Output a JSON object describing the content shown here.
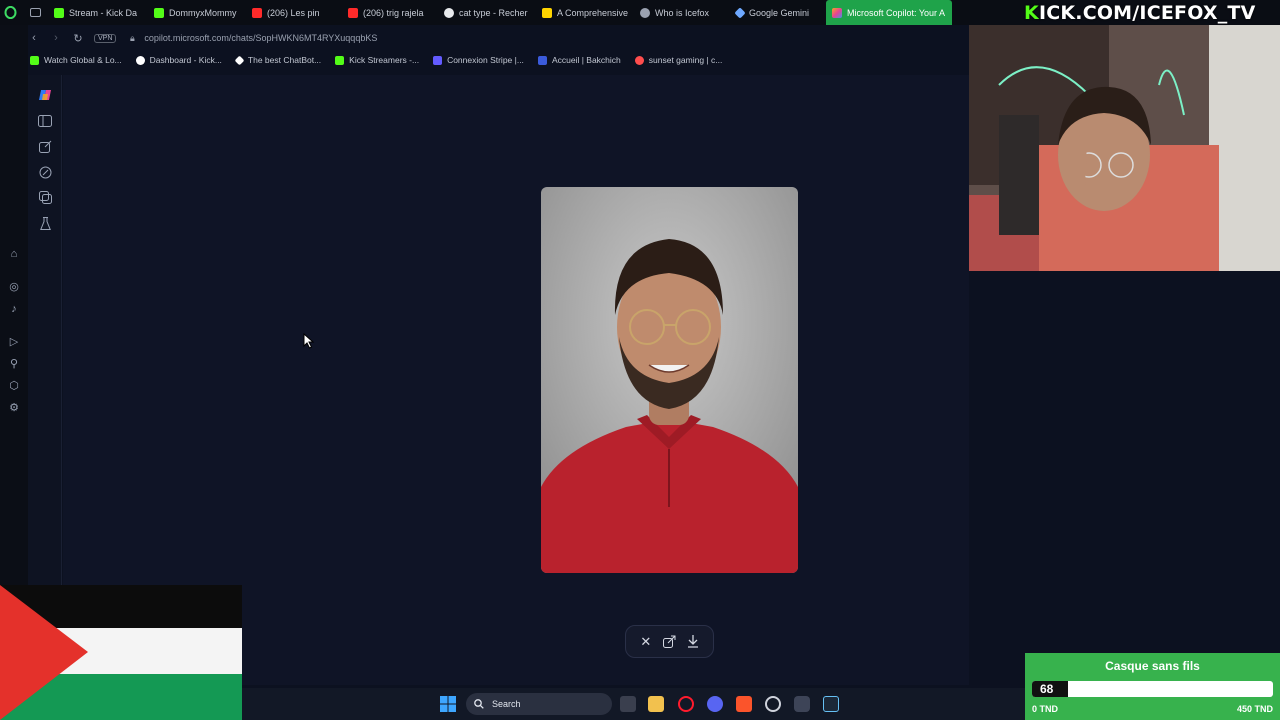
{
  "browser": {
    "tabs": [
      {
        "label": "Stream - Kick Da",
        "color": "#53fc18"
      },
      {
        "label": "DommyxMommy",
        "color": "#53fc18"
      },
      {
        "label": "(206) Les pin",
        "color": "#ff2a2a"
      },
      {
        "label": "(206) trig rajela",
        "color": "#ff2a2a"
      },
      {
        "label": "cat type - Recher",
        "color": "#e8eaed"
      },
      {
        "label": "A Comprehensive",
        "color": "#ffd400"
      },
      {
        "label": "Who is Icefox",
        "color": "#9aa1b0"
      },
      {
        "label": "Google Gemini",
        "color": "#6ea8ff"
      },
      {
        "label": "Microsoft Copilot: Your A",
        "color": "#ffffff",
        "active": true
      }
    ],
    "url": "copilot.microsoft.com/chats/SopHWKN6MT4RYXuqqqbKS",
    "vpn_label": "VPN",
    "bookmarks": [
      {
        "label": "Watch Global & Lo...",
        "color": "#53fc18"
      },
      {
        "label": "Dashboard - Kick...",
        "color": "#ffffff"
      },
      {
        "label": "The best ChatBot...",
        "color": "#ffffff"
      },
      {
        "label": "Kick Streamers -...",
        "color": "#53fc18"
      },
      {
        "label": "Connexion Stripe |...",
        "color": "#635bff"
      },
      {
        "label": "Accueil | Bakchich",
        "color": "#3b5bdb"
      },
      {
        "label": "sunset gaming | c...",
        "color": "#ff4d4d"
      }
    ]
  },
  "image_viewer": {
    "actions": [
      "close-icon",
      "share-icon",
      "download-icon"
    ]
  },
  "stream_overlay": {
    "channel_k": "K",
    "channel_rest": "ICK.COM/ICEFOX_TV"
  },
  "donation_goal": {
    "title": "Casque sans fils",
    "current": "68",
    "progress_fraction": 0.151,
    "min_label": "0 TND",
    "max_label": "450 TND"
  },
  "taskbar": {
    "search_placeholder": "Search"
  }
}
